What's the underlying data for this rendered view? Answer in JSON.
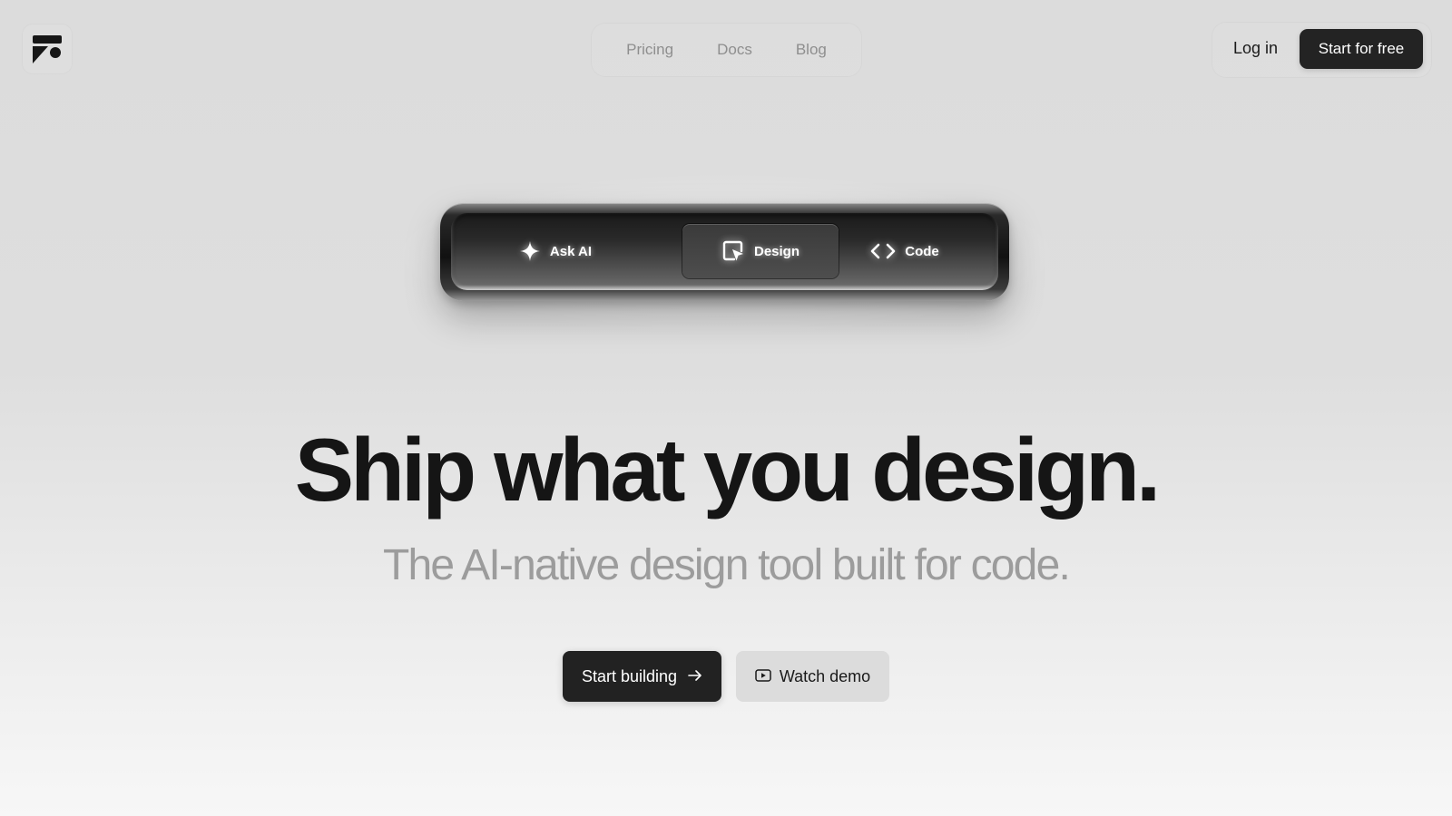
{
  "header": {
    "logo_icon": "brand-logo-icon",
    "nav": [
      {
        "label": "Pricing"
      },
      {
        "label": "Docs"
      },
      {
        "label": "Blog"
      }
    ],
    "login_label": "Log in",
    "cta_label": "Start for free"
  },
  "toolbar": {
    "items": [
      {
        "label": "Ask AI",
        "icon": "sparkle-icon",
        "selected": false
      },
      {
        "label": "Design",
        "icon": "design-cursor-icon",
        "selected": true
      },
      {
        "label": "Code",
        "icon": "code-brackets-icon",
        "selected": false
      }
    ]
  },
  "hero": {
    "headline": "Ship what you design.",
    "subheadline": "The AI-native design tool built for code."
  },
  "cta": {
    "primary_label": "Start building",
    "primary_icon": "arrow-right-icon",
    "secondary_label": "Watch demo",
    "secondary_icon": "play-icon"
  },
  "colors": {
    "dark_button": "#222222",
    "nav_text": "#8e8e8e",
    "subheadline": "#9c9c9c"
  }
}
